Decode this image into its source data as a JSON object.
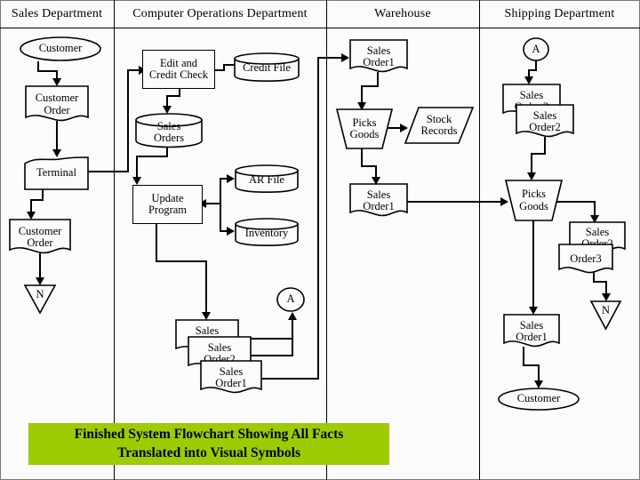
{
  "diagram": {
    "title_caption": {
      "line1": "Finished System Flowchart Showing All Facts",
      "line2": "Translated into Visual Symbols",
      "background_color": "#9BCC04",
      "text_color": "#000000"
    },
    "lanes": [
      {
        "id": "sales",
        "label": "Sales Department"
      },
      {
        "id": "computer_ops",
        "label": "Computer Operations Department"
      },
      {
        "id": "warehouse",
        "label": "Warehouse"
      },
      {
        "id": "shipping",
        "label": "Shipping Department"
      }
    ],
    "nodes": {
      "sales_customer_start": {
        "label": "Customer",
        "shape": "ellipse"
      },
      "sales_customer_order_1": {
        "label": "Customer\nOrder",
        "shape": "document"
      },
      "sales_terminal": {
        "label": "Terminal",
        "shape": "terminal"
      },
      "sales_customer_order_2": {
        "label": "Customer\nOrder",
        "shape": "document"
      },
      "sales_file_n": {
        "label": "N",
        "shape": "triangle"
      },
      "ops_edit_credit_check": {
        "label": "Edit and\nCredit Check",
        "shape": "process"
      },
      "ops_credit_file": {
        "label": "Credit File",
        "shape": "cylinder"
      },
      "ops_sales_orders": {
        "label": "Sales\nOrders",
        "shape": "cylinder"
      },
      "ops_update_program": {
        "label": "Update\nProgram",
        "shape": "process"
      },
      "ops_ar_file": {
        "label": "AR File",
        "shape": "cylinder"
      },
      "ops_inventory": {
        "label": "Inventory",
        "shape": "cylinder"
      },
      "ops_connector_a": {
        "label": "A",
        "shape": "circle"
      },
      "ops_sales_order_3": {
        "label": "Sales\nOrder 3",
        "shape": "document"
      },
      "ops_sales_order_2": {
        "label": "Sales\nOrder2",
        "shape": "document"
      },
      "ops_sales_order_1": {
        "label": "Sales\nOrder1",
        "shape": "document"
      },
      "wh_sales_order_1_in": {
        "label": "Sales\nOrder1",
        "shape": "document"
      },
      "wh_picks_goods": {
        "label": "Picks\nGoods",
        "shape": "trapezoid"
      },
      "wh_stock_records": {
        "label": "Stock\nRecords",
        "shape": "parallelogram"
      },
      "wh_sales_order_1_out": {
        "label": "Sales\nOrder1",
        "shape": "document"
      },
      "ship_connector_a": {
        "label": "A",
        "shape": "circle"
      },
      "ship_sales_order_3": {
        "label": "Sales\nOrder 3",
        "shape": "document"
      },
      "ship_sales_order_2": {
        "label": "Sales\nOrder2",
        "shape": "document"
      },
      "ship_picks_goods": {
        "label": "Picks\nGoods",
        "shape": "trapezoid"
      },
      "ship_sales_order_2b": {
        "label": "Sales\nOrder2",
        "shape": "document"
      },
      "ship_order_3b": {
        "label": "Order3",
        "shape": "document"
      },
      "ship_file_n": {
        "label": "N",
        "shape": "triangle"
      },
      "ship_sales_order_1": {
        "label": "Sales\nOrder1",
        "shape": "document"
      },
      "ship_customer_end": {
        "label": "Customer",
        "shape": "ellipse"
      }
    }
  }
}
